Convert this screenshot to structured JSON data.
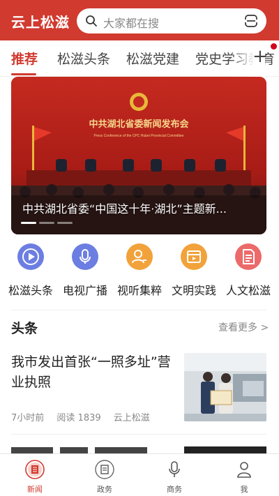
{
  "header": {
    "app_title": "云上松滋",
    "search_placeholder": "大家都在搜",
    "search_icon": "search-icon",
    "scan_icon": "scan-icon"
  },
  "tabs": [
    {
      "label": "推荐",
      "active": true
    },
    {
      "label": "松滋头条",
      "active": false
    },
    {
      "label": "松滋党建",
      "active": false
    },
    {
      "label": "党史学习教育",
      "active": false
    }
  ],
  "tab_add_label": "+",
  "banner": {
    "caption": "中共湖北省委“中国这十年·湖北”主题新...",
    "slide_count": 3,
    "active_slide": 1,
    "backdrop_title": "中共湖北省委新闻发布会",
    "backdrop_subtitle": "Press Conference of the CPC Hubei Provincial Committee"
  },
  "quick_links": [
    {
      "label": "松滋头条",
      "icon": "play-icon",
      "color": "#6c7ee1"
    },
    {
      "label": "电视广播",
      "icon": "microphone-icon",
      "color": "#6c7ee1"
    },
    {
      "label": "视听集粹",
      "icon": "user-profile-icon",
      "color": "#f2a23a"
    },
    {
      "label": "文明实践",
      "icon": "film-icon",
      "color": "#f2a23a"
    },
    {
      "label": "人文松滋",
      "icon": "document-icon",
      "color": "#ec6a6a"
    }
  ],
  "section": {
    "title": "头条",
    "see_more": "查看更多 >"
  },
  "news": [
    {
      "title": "我市发出首张“一照多址”营业执照",
      "time": "7小时前",
      "reads": "阅读 1839",
      "source": "云上松滋"
    }
  ],
  "bottom_nav": [
    {
      "label": "新闻",
      "icon": "news-icon",
      "active": true
    },
    {
      "label": "政务",
      "icon": "government-icon",
      "active": false
    },
    {
      "label": "商务",
      "icon": "microphone-icon",
      "active": false
    },
    {
      "label": "我",
      "icon": "profile-icon",
      "active": false
    }
  ],
  "colors": {
    "brand": "#d13a2f",
    "text": "#222222",
    "muted": "#888888"
  }
}
